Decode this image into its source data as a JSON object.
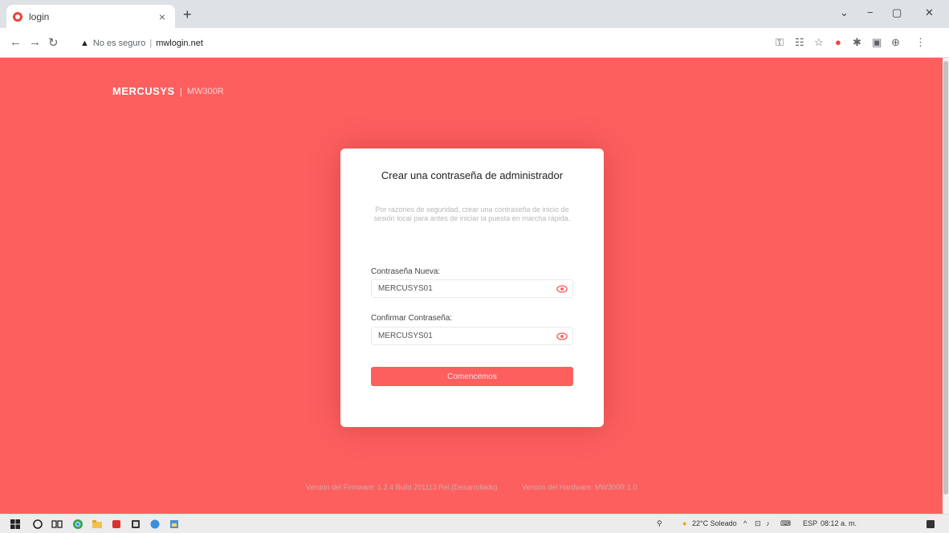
{
  "browser": {
    "tab_title": "login",
    "tab_close": "×",
    "new_tab": "+",
    "security_label": "No es seguro",
    "url": "mwlogin.net",
    "win_minimize": "−",
    "win_restore": "▢",
    "win_close": "✕",
    "tab_search": "⌄"
  },
  "page": {
    "brand": "MERCUSYS",
    "model": "MW300R",
    "card": {
      "title": "Crear una contraseña de administrador",
      "description": "Por razones de seguridad, crear una contraseña de inicio de sesión local para antes de iniciar la puesta en marcha rápida.",
      "new_password_label": "Contraseña Nueva:",
      "new_password_value": "MERCUSYS01",
      "confirm_password_label": "Confirmar Contraseña:",
      "confirm_password_value": "MERCUSYS01",
      "submit_label": "Comencemos"
    },
    "firmware_version": "Versión del Firmware: 1.2.4 Build 201113 Rel.(Desarrollado)",
    "hardware_version": "Versión del Hardware: MW300R 1.0"
  },
  "taskbar": {
    "weather": "22°C Soleado",
    "language": "ESP",
    "time": "08:12 a. m."
  },
  "colors": {
    "page_bg": "#fd5f5f",
    "accent": "#fd5f5f",
    "card_bg": "#ffffff"
  }
}
